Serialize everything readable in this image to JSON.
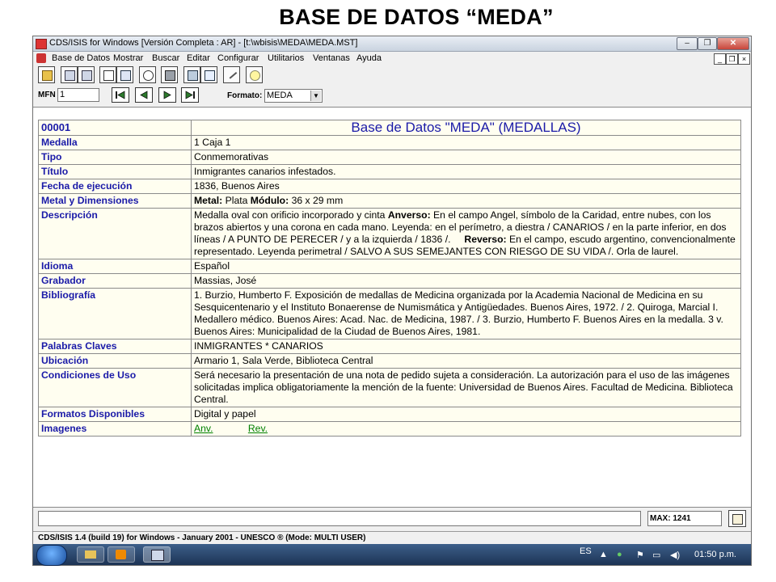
{
  "slide_title": "BASE DE DATOS “MEDA”",
  "window": {
    "title": "CDS/ISIS for Windows [Versión Completa : AR] - [t:\\wbisis\\MEDA\\MEDA.MST]",
    "controls": {
      "minimize": "‒",
      "restore": "❐",
      "close": "✕"
    }
  },
  "menu": [
    "Base de Datos",
    "Mostrar",
    "Buscar",
    "Editar",
    "Configurar",
    "Utilitarios",
    "Ventanas",
    "Ayuda"
  ],
  "mdi_controls": {
    "min": "_",
    "restore": "❐",
    "close": "×"
  },
  "toolbar_icons": [
    "open-folder-icon",
    "print-icon",
    "print-icon",
    "clipboard-icon",
    "copy-icon",
    "search-icon",
    "printer-icon",
    "form-icon",
    "edit-icon",
    "pencil-icon",
    "lightbulb-icon"
  ],
  "navbar": {
    "mfn_label": "MFN",
    "mfn_value": "1",
    "format_label": "Formato:",
    "format_value": "MEDA",
    "nav_glyphs": {
      "first": "|◀",
      "prev": "◀",
      "next": "▶",
      "last": "▶|"
    }
  },
  "record": {
    "mfn": "00001",
    "title": "Base de Datos \"MEDA\" (MEDALLAS)",
    "fields": [
      {
        "label": "Medalla",
        "value": "1 Caja 1"
      },
      {
        "label": "Tipo",
        "value": "Conmemorativas"
      },
      {
        "label": "Título",
        "value": "Inmigrantes canarios infestados."
      },
      {
        "label": "Fecha de ejecución",
        "value": "1836, Buenos Aires"
      }
    ],
    "metal": {
      "label": "Metal y Dimensiones",
      "metal_label": "Metal:",
      "metal_value": "Plata",
      "module_label": "Módulo:",
      "module_value": "36 x 29 mm"
    },
    "description": {
      "label": "Descripción",
      "part1": "Medalla oval con orificio incorporado y cinta ",
      "anverso_label": "Anverso:",
      "part2": " En el campo Angel, símbolo de la Caridad, entre nubes, con los brazos abiertos y una corona en cada mano. Leyenda: en el perímetro, a diestra / CANARIOS / en la parte inferior, en dos líneas / A PUNTO DE PERECER / y a la izquierda / 1836 /.     ",
      "reverso_label": "Reverso:",
      "part3": " En el campo, escudo argentino, convencionalmente representado. Leyenda perimetral / SALVO A SUS SEMEJANTES CON RIESGO DE SU VIDA /. Orla de laurel."
    },
    "fields2": [
      {
        "label": "Idioma",
        "value": "Español"
      },
      {
        "label": "Grabador",
        "value": "Massias, José"
      },
      {
        "label": "Bibliografía",
        "value": "1. Burzio, Humberto F. Exposición de medallas de Medicina organizada por la Academia Nacional de Medicina en su Sesquicentenario y el Instituto Bonaerense de Numismática y Antigüedades. Buenos Aires, 1972. / 2. Quiroga, Marcial I. Medallero médico. Buenos Aires: Acad. Nac. de Medicina, 1987. / 3. Burzio, Humberto F. Buenos Aires en la medalla. 3 v. Buenos Aires: Municipalidad de la Ciudad de Buenos Aires,  1981."
      },
      {
        "label": "Palabras Claves",
        "value": "INMIGRANTES * CANARIOS"
      },
      {
        "label": "Ubicación",
        "value": "Armario 1, Sala Verde, Biblioteca Central"
      },
      {
        "label": "Condiciones de Uso",
        "value": "Será necesario la presentación de una nota de pedido sujeta a consideración. La autorización para el uso de las imágenes solicitadas implica obligatoriamente la mención de la fuente: Universidad de Buenos Aires. Facultad de Medicina. Biblioteca Central."
      },
      {
        "label": "Formatos Disponibles",
        "value": "Digital y papel"
      }
    ],
    "images": {
      "label": "Imagenes",
      "anv": "Anv.",
      "rev": "Rev."
    }
  },
  "status": {
    "max": "MAX: 1241"
  },
  "bottom_line": "CDS/ISIS 1.4 (build 19) for Windows - January 2001 - UNESCO ® (Mode: MULTI USER)",
  "taskbar": {
    "lang": "ES",
    "time": "01:50 p.m.",
    "colors": {
      "start": "#1a4f9e",
      "bar": "#1c3354"
    }
  }
}
